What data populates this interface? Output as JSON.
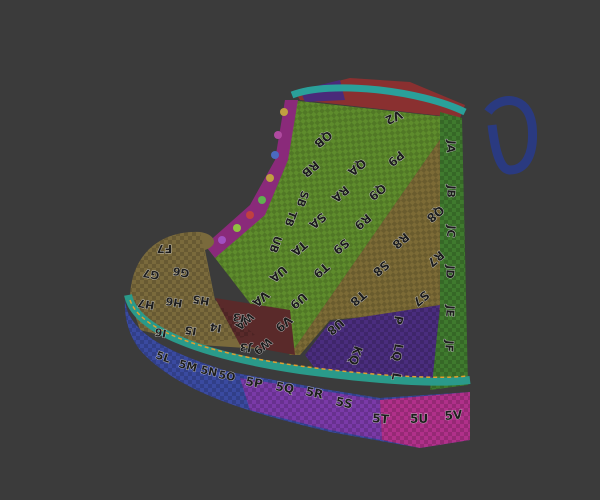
{
  "scene": {
    "subject": "boot-model-uv-checker",
    "background_color": "#3b3b3b",
    "colors": {
      "green": "#5a8a2a",
      "tan": "#7a6a3a",
      "purple": "#4a2a7a",
      "magenta": "#8a2a8a",
      "blue": "#3a4aa0",
      "teal": "#2a9a9a",
      "maroon": "#5a2a2a",
      "violet": "#7a3aa8",
      "pink": "#b0308a"
    }
  },
  "texture_labels": {
    "shaft": [
      "P9",
      "Q9",
      "QA",
      "RA",
      "R9",
      "S9",
      "SA",
      "TA",
      "T9",
      "U9",
      "UA",
      "VA",
      "V9",
      "WA",
      "W9",
      "R8",
      "S8",
      "T8",
      "U8",
      "S7",
      "R7",
      "Q8",
      "QB",
      "RB",
      "SB",
      "TB",
      "UB",
      "V2"
    ],
    "back": [
      "JA",
      "JB",
      "JC",
      "JD",
      "JE",
      "JF"
    ],
    "toe": [
      "F7",
      "G7",
      "G6",
      "H7",
      "H6",
      "H5",
      "I6",
      "I5",
      "I4",
      "I3",
      "J3"
    ],
    "purple": [
      "KQ",
      "LQ",
      "P",
      "L"
    ],
    "sole": [
      "5L",
      "5M",
      "5N",
      "5O",
      "5P",
      "5Q",
      "5R",
      "5S",
      "5T",
      "5U",
      "5V"
    ]
  }
}
